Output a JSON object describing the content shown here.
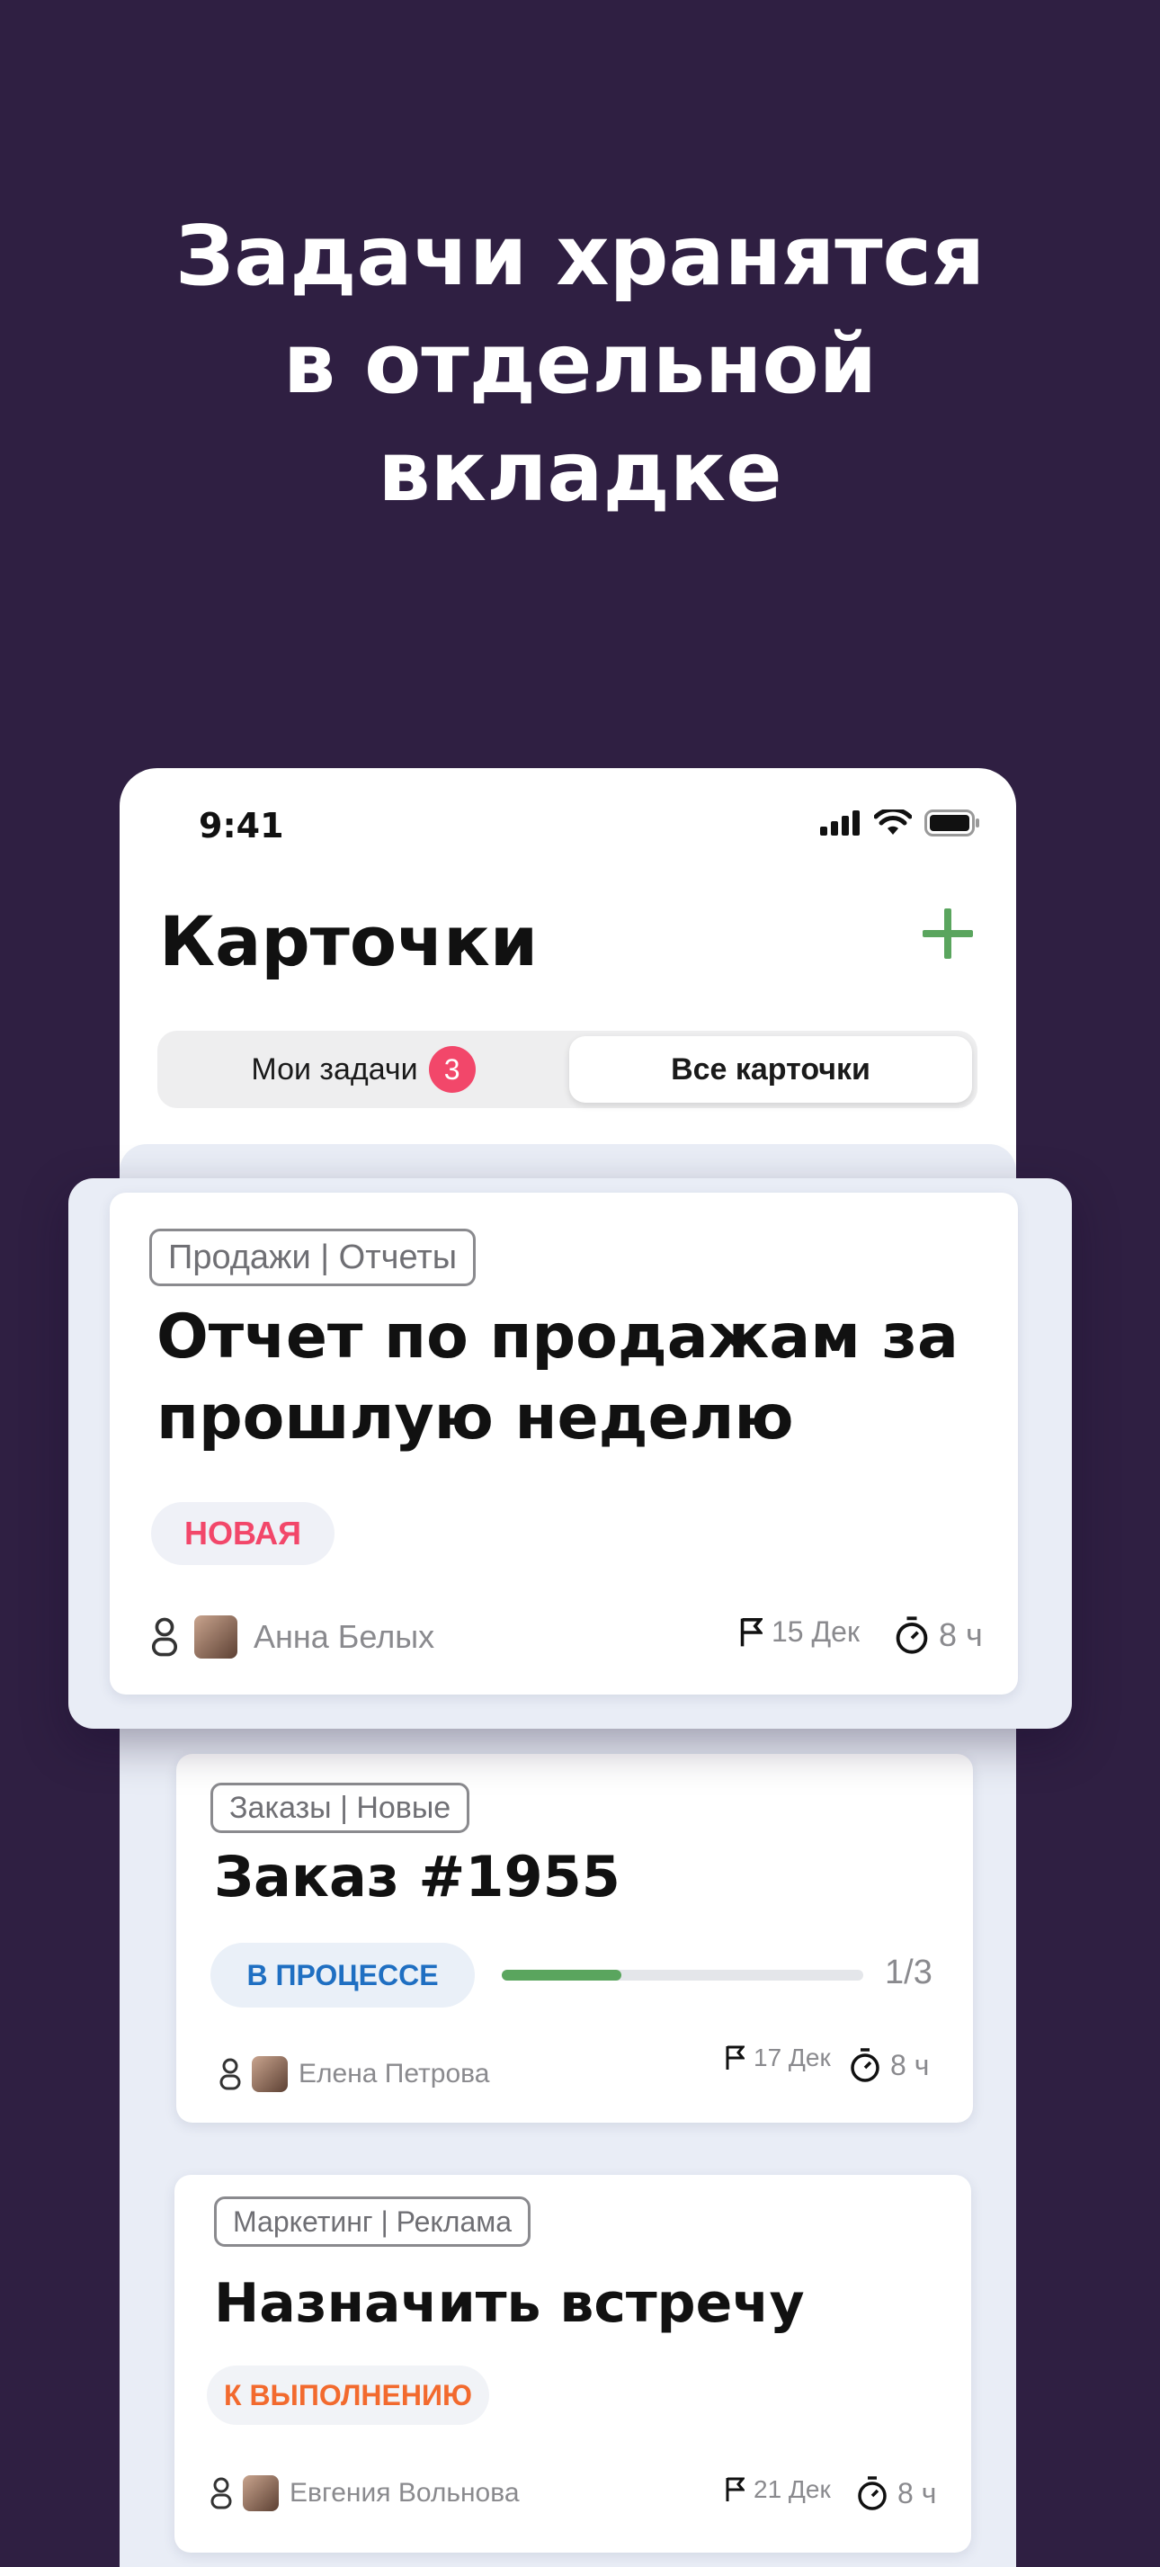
{
  "headline": {
    "line1": "Задачи хранятся",
    "line2": "в отдельной",
    "line3": "вкладке"
  },
  "status_bar": {
    "time": "9:41"
  },
  "header": {
    "title": "Карточки",
    "add_icon": "plus-icon"
  },
  "tabs": {
    "mine_label": "Мои задачи",
    "mine_count": "3",
    "all_label": "Все карточки",
    "selected": "Все карточки"
  },
  "colors": {
    "background": "#2f1f42",
    "accent_green": "#5aa55e",
    "badge_red": "#f2476a",
    "status_new": "#f2476a",
    "status_progress": "#1f6fc2",
    "status_todo": "#f26a2e"
  },
  "cards": [
    {
      "tag": "Продажи | Отчеты",
      "title_line1": "Отчет по продажам за",
      "title_line2": "прошлую неделю",
      "status": "НОВАЯ",
      "assignee": "Анна Белых",
      "date": "15 Дек",
      "duration": "8 ч"
    },
    {
      "tag": "Заказы | Новые",
      "title": "Заказ  #1955",
      "status": "В ПРОЦЕССЕ",
      "progress": 0.33,
      "progress_label": "1/3",
      "assignee": "Елена Петрова",
      "date": "17 Дек",
      "duration": "8 ч"
    },
    {
      "tag": "Маркетинг | Реклама",
      "title": "Назначить встречу",
      "status": "К ВЫПОЛНЕНИЮ",
      "assignee": "Евгения Вольнова",
      "date": "21 Дек",
      "duration": "8 ч"
    }
  ]
}
